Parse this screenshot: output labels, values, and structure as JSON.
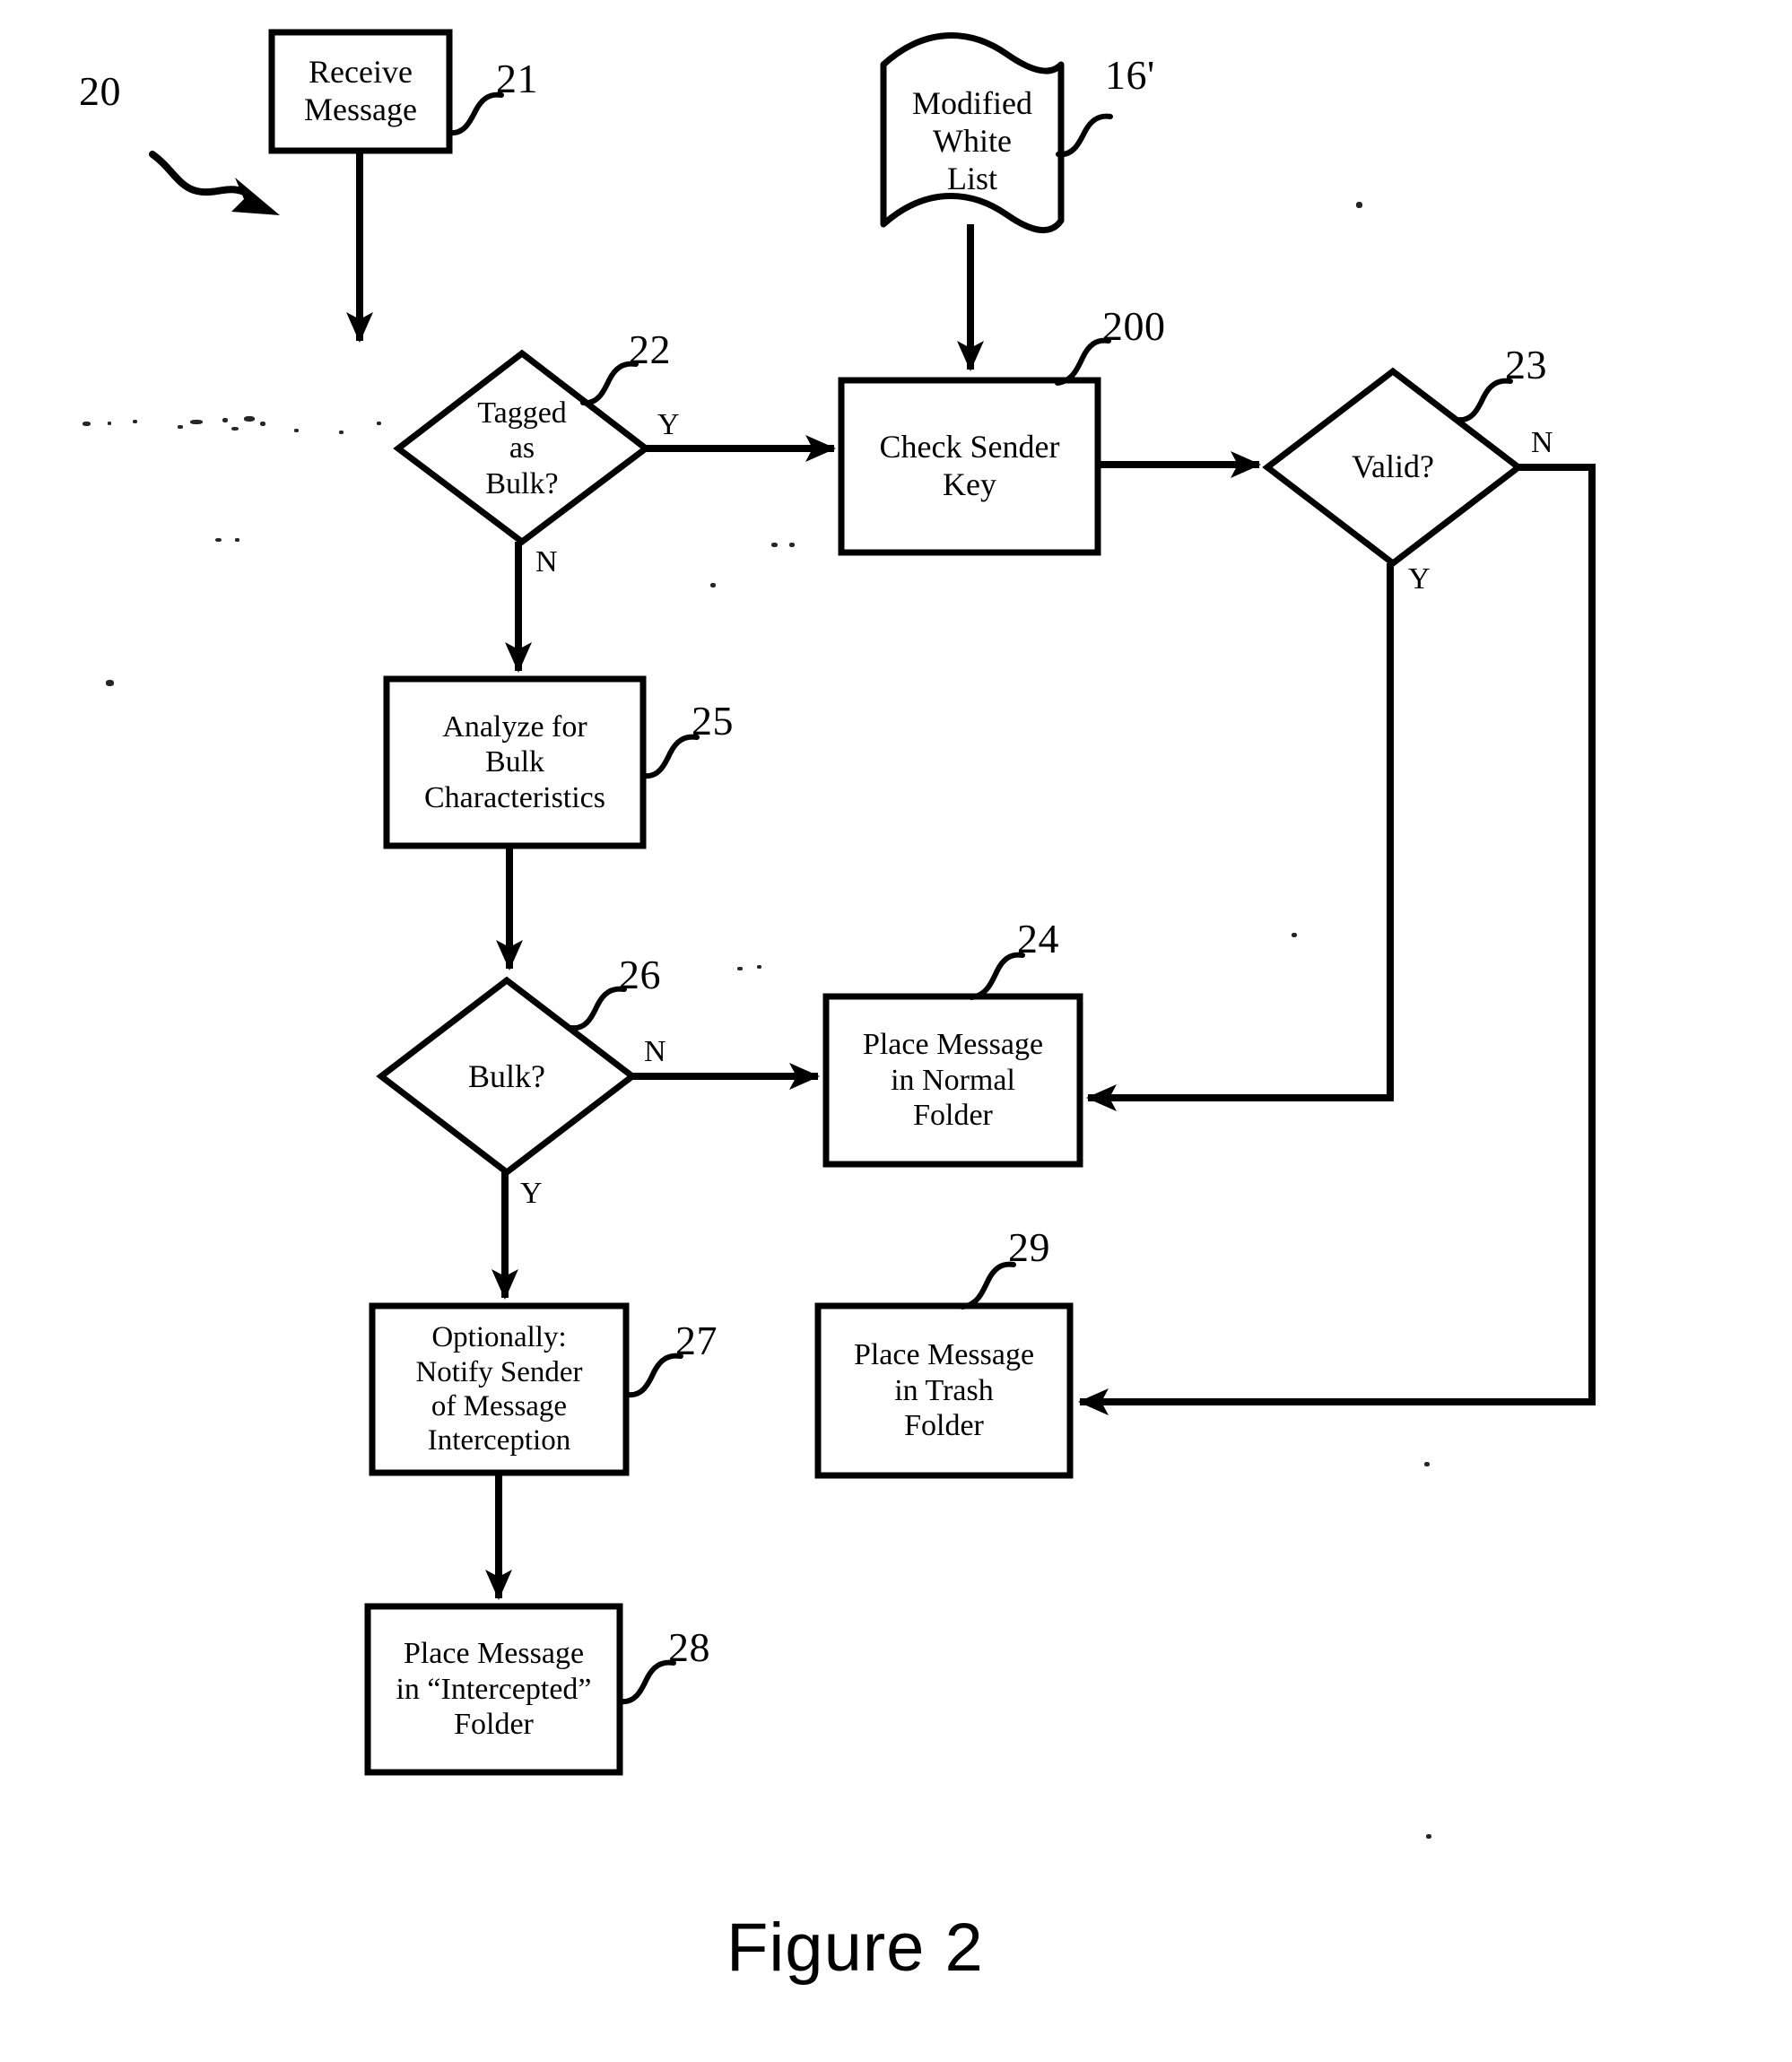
{
  "figure": {
    "caption": "Figure 2",
    "diagram_ref": "20",
    "type": "flowchart",
    "description": "Patent flowchart for message bulk detection and white-list sender key validation"
  },
  "nodes": {
    "receive_message": {
      "ref": "21",
      "label": "Receive\nMessage",
      "shape": "process"
    },
    "modified_white_list": {
      "ref": "16'",
      "label": "Modified\nWhite\nList",
      "shape": "document"
    },
    "tagged_as_bulk": {
      "ref": "22",
      "label": "Tagged\nas\nBulk?",
      "shape": "decision"
    },
    "check_sender_key": {
      "ref": "200",
      "label": "Check Sender\nKey",
      "shape": "process"
    },
    "valid": {
      "ref": "23",
      "label": "Valid?",
      "shape": "decision"
    },
    "analyze_for_bulk": {
      "ref": "25",
      "label": "Analyze for\nBulk\nCharacteristics",
      "shape": "process"
    },
    "bulk": {
      "ref": "26",
      "label": "Bulk?",
      "shape": "decision"
    },
    "place_normal": {
      "ref": "24",
      "label": "Place Message\nin Normal\nFolder",
      "shape": "process"
    },
    "notify_sender": {
      "ref": "27",
      "label": "Optionally:\nNotify Sender\nof Message\nInterception",
      "shape": "process"
    },
    "place_trash": {
      "ref": "29",
      "label": "Place Message\nin Trash\nFolder",
      "shape": "process"
    },
    "place_intercepted": {
      "ref": "28",
      "label": "Place Message\nin “Intercepted”\nFolder",
      "shape": "process"
    }
  },
  "branch_labels": {
    "tagged_yes": "Y",
    "tagged_no": "N",
    "valid_no": "N",
    "valid_yes": "Y",
    "bulk_no": "N",
    "bulk_yes": "Y"
  },
  "edges": [
    {
      "from": "receive_message",
      "to": "tagged_as_bulk",
      "label": ""
    },
    {
      "from": "modified_white_list",
      "to": "check_sender_key",
      "label": ""
    },
    {
      "from": "tagged_as_bulk",
      "to": "check_sender_key",
      "label": "Y"
    },
    {
      "from": "tagged_as_bulk",
      "to": "analyze_for_bulk",
      "label": "N"
    },
    {
      "from": "check_sender_key",
      "to": "valid",
      "label": ""
    },
    {
      "from": "valid",
      "to": "place_normal",
      "label": "Y"
    },
    {
      "from": "valid",
      "to": "place_trash",
      "label": "N"
    },
    {
      "from": "analyze_for_bulk",
      "to": "bulk",
      "label": ""
    },
    {
      "from": "bulk",
      "to": "place_normal",
      "label": "N"
    },
    {
      "from": "bulk",
      "to": "notify_sender",
      "label": "Y"
    },
    {
      "from": "notify_sender",
      "to": "place_intercepted",
      "label": ""
    }
  ]
}
